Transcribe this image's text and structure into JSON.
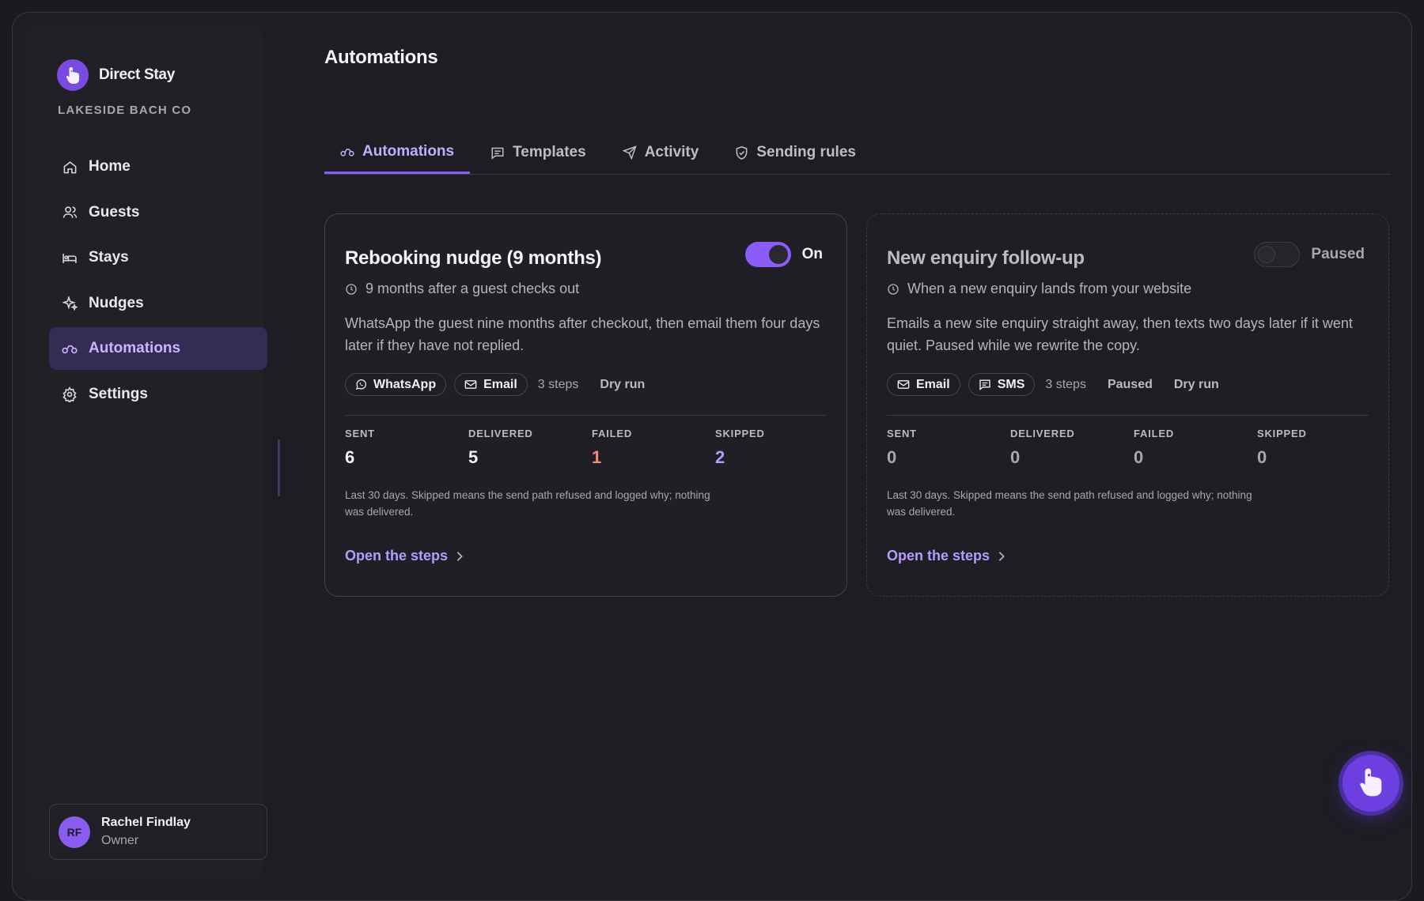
{
  "brand": {
    "name": "Direct Stay",
    "org": "LAKESIDE BACH CO"
  },
  "sidebar": {
    "items": [
      {
        "label": "Home",
        "icon": "home-icon"
      },
      {
        "label": "Guests",
        "icon": "users-icon"
      },
      {
        "label": "Stays",
        "icon": "bed-icon"
      },
      {
        "label": "Nudges",
        "icon": "sparkle-icon"
      },
      {
        "label": "Automations",
        "icon": "automation-icon",
        "active": true
      },
      {
        "label": "Settings",
        "icon": "gear-icon"
      }
    ]
  },
  "user": {
    "initials": "RF",
    "name": "Rachel Findlay",
    "role": "Owner"
  },
  "page": {
    "title": "Automations"
  },
  "tabs": [
    {
      "label": "Automations",
      "icon": "automation-icon",
      "active": true
    },
    {
      "label": "Templates",
      "icon": "message-icon"
    },
    {
      "label": "Activity",
      "icon": "send-icon"
    },
    {
      "label": "Sending rules",
      "icon": "shield-icon"
    }
  ],
  "cards": [
    {
      "title": "Rebooking nudge (9 months)",
      "toggle_on": true,
      "toggle_label": "On",
      "trigger": "9 months after a guest checks out",
      "description": "WhatsApp the guest nine months after checkout, then email them four days later if they have not replied.",
      "chips": [
        "WhatsApp",
        "Email"
      ],
      "steps": "3 steps",
      "status": "",
      "mode": "Dry run",
      "stats": {
        "sent_label": "SENT",
        "sent": "6",
        "delivered_label": "DELIVERED",
        "delivered": "5",
        "failed_label": "FAILED",
        "failed": "1",
        "skipped_label": "SKIPPED",
        "skipped": "2"
      },
      "note": "Last 30 days. Skipped means the send path refused and logged why; nothing was delivered.",
      "link": "Open the steps"
    },
    {
      "title": "New enquiry follow-up",
      "toggle_on": false,
      "toggle_label": "Paused",
      "trigger": "When a new enquiry lands from your website",
      "description": "Emails a new site enquiry straight away, then texts two days later if it went quiet. Paused while we rewrite the copy.",
      "chips": [
        "Email",
        "SMS"
      ],
      "steps": "3 steps",
      "status": "Paused",
      "mode": "Dry run",
      "stats": {
        "sent_label": "SENT",
        "sent": "0",
        "delivered_label": "DELIVERED",
        "delivered": "0",
        "failed_label": "FAILED",
        "failed": "0",
        "skipped_label": "SKIPPED",
        "skipped": "0"
      },
      "note": "Last 30 days. Skipped means the send path refused and logged why; nothing was delivered.",
      "link": "Open the steps"
    }
  ],
  "colors": {
    "accent": "#8b5cf6",
    "failed": "#f48a7c",
    "skipped": "#b79aff",
    "background": "#1e1d24"
  }
}
